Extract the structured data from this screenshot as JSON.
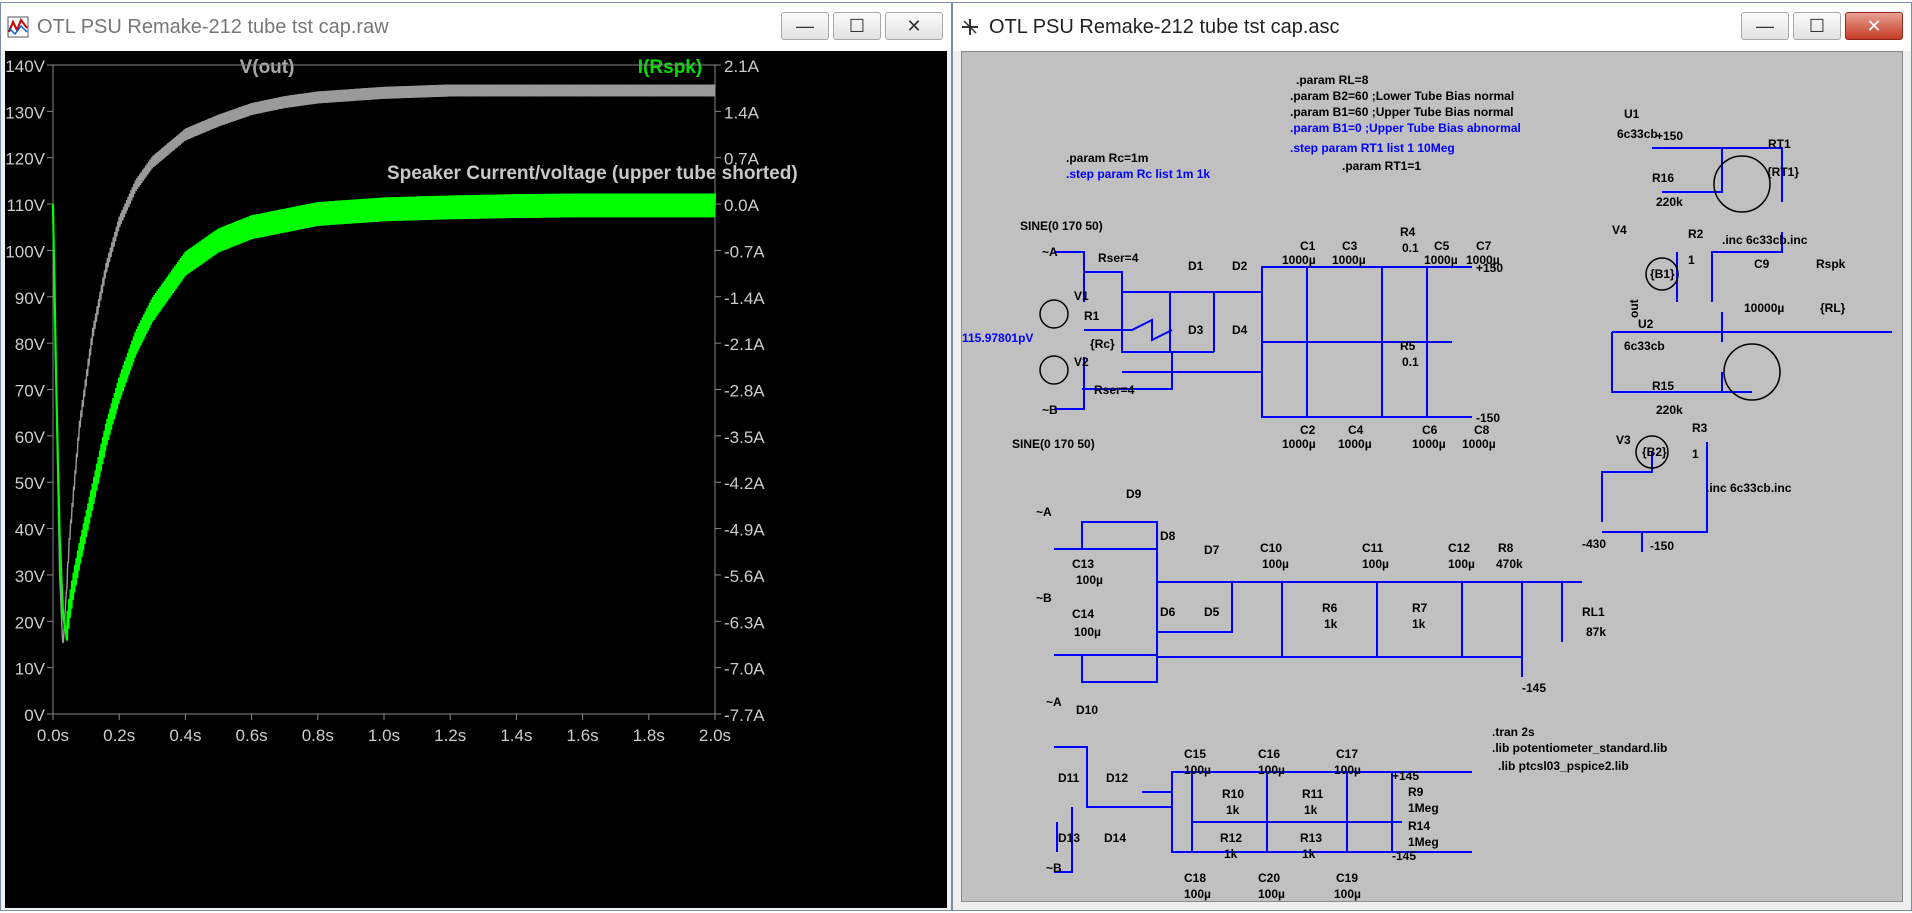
{
  "waveform_window": {
    "title": "OTL PSU Remake-212 tube tst cap.raw",
    "ctrl_min": "—",
    "ctrl_max": "☐",
    "ctrl_close": "✕"
  },
  "schematic_window": {
    "title": "OTL PSU Remake-212 tube tst cap.asc",
    "ctrl_min": "—",
    "ctrl_max": "☐",
    "ctrl_close": "✕"
  },
  "colors": {
    "trace_vout": "#9a9a9a",
    "trace_irspk": "#00ff00",
    "wire": "#0000ff",
    "directive_blue": "#0000ff",
    "plot_bg": "#000000",
    "schematic_bg": "#c0c0c0"
  },
  "chart_data": {
    "type": "line",
    "series": [
      {
        "name": "V(out)",
        "axis": "left",
        "color": "#9a9a9a",
        "x": [
          0,
          0.01,
          0.02,
          0.03,
          0.05,
          0.08,
          0.12,
          0.16,
          0.2,
          0.25,
          0.3,
          0.4,
          0.5,
          0.6,
          0.7,
          0.8,
          1.0,
          1.2,
          1.4,
          1.6,
          1.8,
          2.0
        ],
        "values": [
          110,
          70,
          30,
          14,
          38,
          62,
          82,
          96,
          106,
          114,
          119,
          125,
          128,
          130.5,
          132,
          133,
          134,
          134.5,
          134.5,
          134.5,
          134.5,
          134.5
        ]
      },
      {
        "name": "I(Rspk)",
        "axis": "right",
        "color": "#00ff00",
        "x": [
          0,
          0.01,
          0.02,
          0.03,
          0.04,
          0.05,
          0.06,
          0.08,
          0.12,
          0.16,
          0.2,
          0.25,
          0.3,
          0.4,
          0.5,
          0.6,
          0.7,
          0.8,
          1.0,
          1.2,
          1.4,
          1.6,
          1.8,
          2.0
        ],
        "values": [
          0,
          -2.8,
          -5.0,
          -6.2,
          -6.5,
          -6.1,
          -5.8,
          -5.3,
          -4.4,
          -3.5,
          -2.8,
          -2.1,
          -1.6,
          -0.9,
          -0.55,
          -0.35,
          -0.25,
          -0.15,
          -0.08,
          -0.05,
          -0.03,
          -0.02,
          -0.02,
          -0.02
        ]
      }
    ],
    "xlim": [
      0,
      2.0
    ],
    "ylim_left": [
      0,
      140
    ],
    "ylim_right": [
      -7.7,
      2.1
    ],
    "x_ticks": [
      "0.0s",
      "0.2s",
      "0.4s",
      "0.6s",
      "0.8s",
      "1.0s",
      "1.2s",
      "1.4s",
      "1.6s",
      "1.8s",
      "2.0s"
    ],
    "y_left_ticks": [
      "0V",
      "10V",
      "20V",
      "30V",
      "40V",
      "50V",
      "60V",
      "70V",
      "80V",
      "90V",
      "100V",
      "110V",
      "120V",
      "130V",
      "140V"
    ],
    "y_right_ticks": [
      "-7.7A",
      "-7.0A",
      "-6.3A",
      "-5.6A",
      "-4.9A",
      "-4.2A",
      "-3.5A",
      "-2.8A",
      "-2.1A",
      "-1.4A",
      "-0.7A",
      "0.0A",
      "0.7A",
      "1.4A",
      "2.1A"
    ],
    "legend": [
      "V(out)",
      "I(Rspk)"
    ],
    "annotation": "Speaker Current/voltage (upper tube shorted)"
  },
  "schematic": {
    "directives": {
      "rl": ".param RL=8",
      "b2": ".param B2=60 ;Lower Tube Bias normal",
      "b1": ".param B1=60 ;Upper Tube Bias normal",
      "b1_abn": ".param B1=0 ;Upper Tube Bias abnormal",
      "step_rt1": ".step param RT1 list 1 10Meg",
      "rt1": ".param RT1=1",
      "rc": ".param Rc=1m",
      "step_rc": ".step param Rc list 1m 1k",
      "inc1": ".inc 6c33cb.inc",
      "inc2": ".inc 6c33cb.inc",
      "tran": ".tran 2s",
      "lib1": ".lib potentiometer_standard.lib",
      "lib2": ".lib ptcsl03_pspice2.lib"
    },
    "labels": {
      "sine1": "SINE(0 170 50)",
      "sine2": "SINE(0 170 50)",
      "rser1": "Rser=4",
      "rser2": "Rser=4",
      "v1": "V1",
      "v2": "V2",
      "r1": "R1",
      "rc_val": "{Rc}",
      "pv": "115.97801pV",
      "d1": "D1",
      "d2": "D2",
      "d3": "D3",
      "d4": "D4",
      "c1": "C1",
      "c1v": "1000µ",
      "c3": "C3",
      "c3v": "1000µ",
      "r4": "R4",
      "r4v": "0.1",
      "c5": "C5",
      "c5v": "1000µ",
      "c7": "C7",
      "c7v": "1000µ",
      "r5": "R5",
      "r5v": "0.1",
      "c2": "C2",
      "c2v": "1000µ",
      "c4": "C4",
      "c4v": "1000µ",
      "c6": "C6",
      "c6v": "1000µ",
      "c8": "C8",
      "c8v": "1000µ",
      "d9": "D9",
      "d8": "D8",
      "d7": "D7",
      "d6": "D6",
      "d5": "D5",
      "d10": "D10",
      "c13": "C13",
      "c13v": "100µ",
      "c14": "C14",
      "c14v": "100µ",
      "c10": "C10",
      "c10v": "100µ",
      "c11": "C11",
      "c11v": "100µ",
      "c12": "C12",
      "c12v": "100µ",
      "r6": "R6",
      "r6v": "1k",
      "r7": "R7",
      "r7v": "1k",
      "r8": "R8",
      "r8v": "470k",
      "rl1": "RL1",
      "rl1v": "87k",
      "d11": "D11",
      "d12": "D12",
      "d13": "D13",
      "d14": "D14",
      "c15": "C15",
      "c15v": "100µ",
      "c16": "C16",
      "c16v": "100µ",
      "c17": "C17",
      "c17v": "100µ",
      "r10": "R10",
      "r10v": "1k",
      "r11": "R11",
      "r11v": "1k",
      "r12": "R12",
      "r12v": "1k",
      "r13": "R13",
      "r13v": "1k",
      "r9": "R9",
      "r9v": "1Meg",
      "r14": "R14",
      "r14v": "1Meg",
      "c18": "C18",
      "c18v": "100µ",
      "c20": "C20",
      "c20v": "100µ",
      "c19": "C19",
      "c19v": "100µ",
      "u1": "U1",
      "u1t": "6c33cb",
      "u2": "U2",
      "u2t": "6c33cb",
      "rt1": "RT1",
      "rt1v": "{RT1}",
      "r16": "R16",
      "r16v": "220k",
      "r15": "R15",
      "r15v": "220k",
      "r2": "R2",
      "r2v": "1",
      "r3": "R3",
      "r3v": "1",
      "v4": "V4",
      "b1": "{B1}",
      "v3": "V3",
      "b2": "{B2}",
      "out": "out",
      "c9": "C9",
      "c9v": "10000µ",
      "rspk": "Rspk",
      "rlv": "{RL}"
    },
    "ports": {
      "a1": "~A",
      "b1": "~B",
      "a2": "~A",
      "b2": "~B",
      "a3": "~A",
      "b3": "~B",
      "p150": "+150",
      "m150": "-150",
      "m430": "-430",
      "m145": "-145",
      "p145": "+145",
      "m145b": "-145",
      "p150u": "+150",
      "m150u": "-150"
    }
  }
}
